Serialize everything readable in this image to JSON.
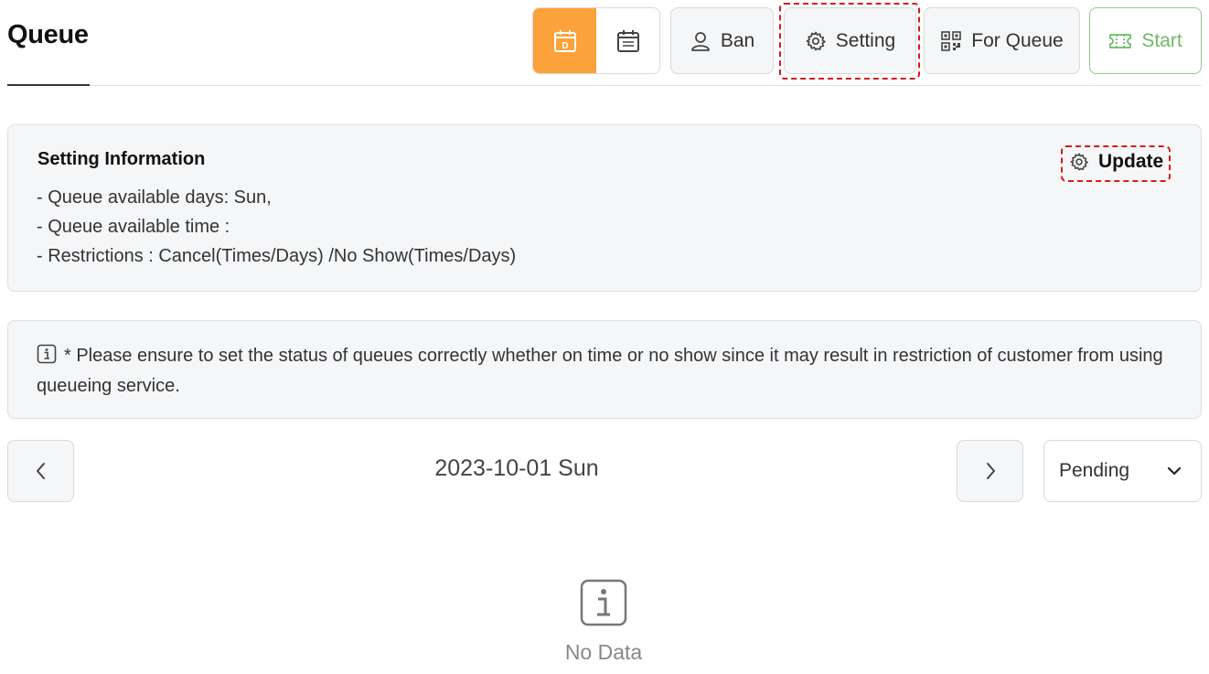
{
  "header": {
    "title": "Queue"
  },
  "toolbar": {
    "view_toggle": {
      "day_icon": "calendar-day-icon",
      "day_letter": "D",
      "month_icon": "calendar-month-icon",
      "active": "day"
    },
    "ban_label": "Ban",
    "ban_icon": "user-icon",
    "setting_label": "Setting",
    "setting_icon": "gear-icon",
    "for_queue_label": "For Queue",
    "for_queue_icon": "qr-code-icon",
    "start_label": "Start",
    "start_icon": "ticket-icon"
  },
  "setting_info": {
    "title": "Setting Information",
    "lines": [
      "- Queue available days: Sun,",
      "- Queue available time :",
      "- Restrictions : Cancel(Times/Days) /No Show(Times/Days)"
    ],
    "update_label": "Update",
    "update_icon": "gear-icon"
  },
  "notice": {
    "icon": "info-icon",
    "text": "* Please ensure to set the status of queues correctly whether on time or no show since it may result in restriction of customer from using queueing service."
  },
  "date_nav": {
    "prev_icon": "chevron-left-icon",
    "date": "2023-10-01 Sun",
    "next_icon": "chevron-right-icon"
  },
  "status_filter": {
    "selected": "Pending",
    "icon": "chevron-down-icon"
  },
  "empty_state": {
    "icon": "info-icon",
    "text": "No Data"
  },
  "colors": {
    "accent": "#fca23a",
    "start_green": "#6cba64",
    "highlight_red": "#d81b1b"
  }
}
